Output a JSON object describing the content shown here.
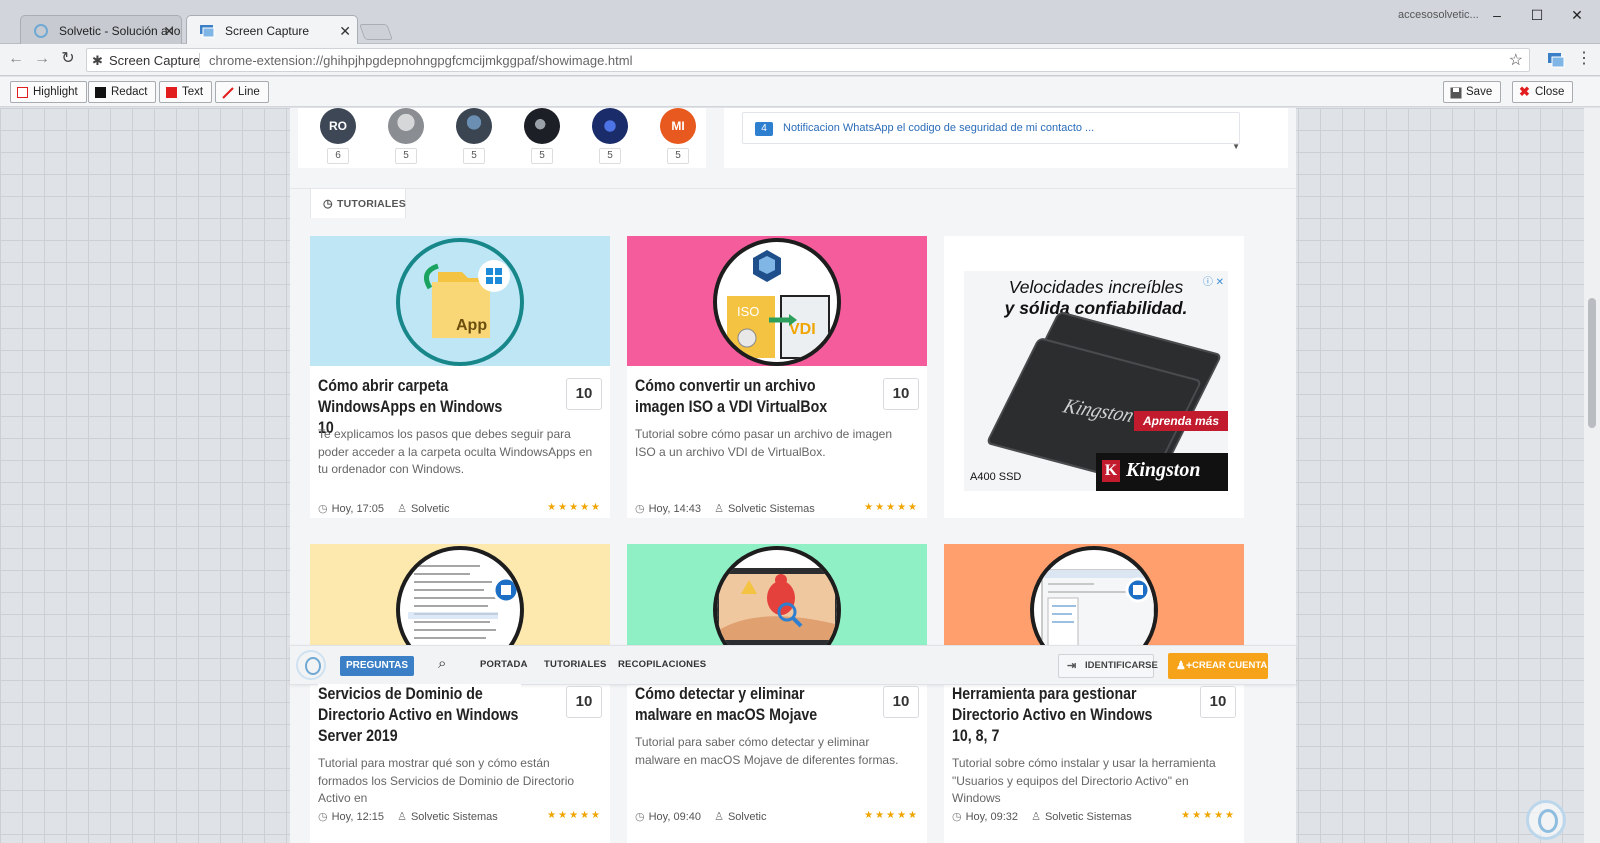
{
  "browser": {
    "tabs": [
      {
        "title": "Solvetic - Solución a los"
      },
      {
        "title": "Screen Capture"
      }
    ],
    "user": "accesosolvetic...",
    "address": {
      "site": "Screen Capture",
      "url": "chrome-extension://ghihpjhpgdepnohngpgfcmcijmkggpaf/showimage.html"
    }
  },
  "capture_toolbar": {
    "highlight": "Highlight",
    "redact": "Redact",
    "text": "Text",
    "line": "Line",
    "save": "Save",
    "close": "Close"
  },
  "colors": {
    "highlight": "#ffffff",
    "redact": "#111111",
    "text": "#e21d1d",
    "line": "#e21d1d",
    "accent": "#3b80c6",
    "signup": "#f7a31a"
  },
  "avatars": [
    {
      "initials": "RO",
      "count": "6",
      "color": "#3d4756"
    },
    {
      "initials": "",
      "count": "5",
      "color": "#8a8d91"
    },
    {
      "initials": "",
      "count": "5",
      "color": "#3b4552"
    },
    {
      "initials": "",
      "count": "5",
      "color": "#1c1f25"
    },
    {
      "initials": "",
      "count": "5",
      "color": "#1b2c6b"
    },
    {
      "initials": "MI",
      "count": "5",
      "color": "#e8591f"
    }
  ],
  "notification": {
    "count": "4",
    "text": "Notificacion WhatsApp el codigo de seguridad de mi contacto ..."
  },
  "section": {
    "label": "TUTORIALES"
  },
  "cards": [
    {
      "title": "Cómo abrir carpeta WindowsApps en Windows 10",
      "score": "10",
      "desc": "Te explicamos los pasos que debes seguir para poder acceder a la carpeta oculta WindowsApps en tu ordenador con Windows.",
      "time": "Hoy, 17:05",
      "author": "Solvetic",
      "bg": "#bfe6f5",
      "thumb_label": "App"
    },
    {
      "title": "Cómo convertir un archivo imagen ISO a VDI VirtualBox",
      "score": "10",
      "desc": "Tutorial sobre cómo pasar un archivo de imagen ISO a un archivo VDI de VirtualBox.",
      "time": "Hoy, 14:43",
      "author": "Solvetic Sistemas",
      "bg": "#f45c9c",
      "thumb_label_a": "ISO",
      "thumb_label_b": "VDI"
    },
    {
      "title": "Servicios de Dominio de Directorio Activo en Windows Server 2019",
      "score": "10",
      "desc": "Tutorial para mostrar qué son y cómo están formados los Servicios de Dominio de Directorio Activo en",
      "time": "Hoy, 12:15",
      "author": "Solvetic Sistemas",
      "bg": "#fde9ad"
    },
    {
      "title": "Cómo detectar y eliminar malware en macOS Mojave",
      "score": "10",
      "desc": "Tutorial para saber cómo detectar y eliminar malware en macOS Mojave de diferentes formas.",
      "time": "Hoy, 09:40",
      "author": "Solvetic",
      "bg": "#8ff0c6"
    },
    {
      "title": "Herramienta para gestionar Directorio Activo en Windows 10, 8, 7",
      "score": "10",
      "desc": "Tutorial sobre cómo instalar y usar la herramienta \"Usuarios y equipos del Directorio Activo\" en Windows",
      "time": "Hoy, 09:32",
      "author": "Solvetic Sistemas",
      "bg": "#ff9f6e"
    }
  ],
  "ad": {
    "headline_1": "Velocidades increíbles",
    "headline_2": "y sólida confiabilidad.",
    "ssd_brand": "Kingston",
    "cta": "Aprenda más",
    "model": "A400 SSD",
    "logo": "Kingston",
    "logo_sub": "TECHNOLOGY"
  },
  "nav": {
    "questions": "PREGUNTAS",
    "home": "PORTADA",
    "tutorials": "TUTORIALES",
    "collections": "RECOPILACIONES",
    "login": "IDENTIFICARSE",
    "signup": "CREAR CUENTA"
  }
}
